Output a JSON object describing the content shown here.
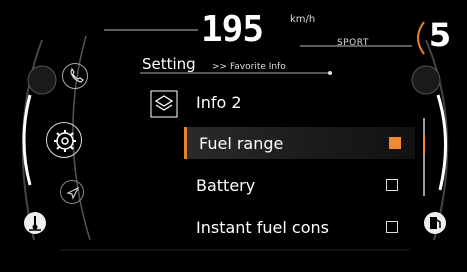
{
  "header": {
    "speed": "195",
    "speed_unit": "km/h",
    "ride_mode": "SPORT",
    "gear": "5"
  },
  "menu": {
    "title": "Setting",
    "breadcrumb": ">> Favorite Info",
    "section_title": "Info 2",
    "items": [
      {
        "label": "Fuel range",
        "checked": true,
        "selected": true
      },
      {
        "label": "Battery",
        "checked": false,
        "selected": false
      },
      {
        "label": "Instant fuel cons",
        "checked": false,
        "selected": false
      }
    ]
  },
  "left_nav": {
    "icons": [
      "phone-icon",
      "settings-gear-icon",
      "navigation-arrow-icon",
      "coolant-temperature-icon"
    ]
  },
  "right_gauge": {
    "icons": [
      "fuel-pump-icon"
    ]
  },
  "colors": {
    "accent": "#f08a30",
    "background": "#000000",
    "text": "#ffffff"
  }
}
